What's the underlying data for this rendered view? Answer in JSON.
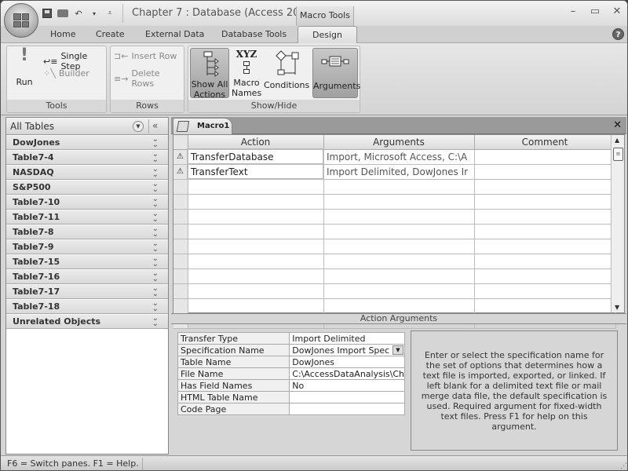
{
  "window": {
    "title": "Chapter 7 : Database (Access 20...",
    "context_tab_group": "Macro Tools",
    "controls": {
      "minimize": "–",
      "maximize": "▭",
      "close": "✕"
    }
  },
  "quick_access": [
    "save-icon",
    "print-icon",
    "undo-icon",
    "undo-dropdown-icon",
    "customize-icon"
  ],
  "tabs": [
    {
      "label": "Home",
      "active": false
    },
    {
      "label": "Create",
      "active": false
    },
    {
      "label": "External Data",
      "active": false
    },
    {
      "label": "Database Tools",
      "active": false
    },
    {
      "label": "Design",
      "active": true
    }
  ],
  "help_label": "?",
  "ribbon": {
    "groups": [
      {
        "label": "Tools",
        "run": "Run",
        "single_step": "Single Step",
        "builder": "Builder"
      },
      {
        "label": "Rows",
        "insert_row": "Insert Row",
        "delete_rows": "Delete Rows"
      },
      {
        "label": "Show/Hide",
        "show_all_actions": [
          "Show All",
          "Actions"
        ],
        "macro_names": [
          "Macro",
          "Names"
        ],
        "conditions": "Conditions",
        "arguments": "Arguments",
        "xyz": "XYZ"
      }
    ]
  },
  "nav_pane": {
    "title": "All Tables",
    "items": [
      "DowJones",
      "Table7-4",
      "NASDAQ",
      "S&P500",
      "Table7-10",
      "Table7-11",
      "Table7-8",
      "Table7-9",
      "Table7-15",
      "Table7-16",
      "Table7-17",
      "Table7-18",
      "Unrelated Objects"
    ]
  },
  "document": {
    "tab_label": "Macro1",
    "close": "✕",
    "columns": [
      "Action",
      "Arguments",
      "Comment"
    ],
    "rows": [
      {
        "warn": "⚠",
        "action": "TransferDatabase",
        "arguments": "Import, Microsoft Access, C:\\A",
        "comment": ""
      },
      {
        "warn": "⚠",
        "action": "TransferText",
        "arguments": "Import Delimited, DowJones Ir",
        "comment": ""
      }
    ],
    "empty_rows": 10
  },
  "action_arguments": {
    "header": "Action Arguments",
    "fields": [
      {
        "name": "Transfer Type",
        "value": "Import Delimited"
      },
      {
        "name": "Specification Name",
        "value": "DowJones Import Spec",
        "dropdown": true
      },
      {
        "name": "Table Name",
        "value": "DowJones"
      },
      {
        "name": "File Name",
        "value": "C:\\AccessDataAnalysis\\Ch"
      },
      {
        "name": "Has Field Names",
        "value": "No"
      },
      {
        "name": "HTML Table Name",
        "value": ""
      },
      {
        "name": "Code Page",
        "value": ""
      }
    ],
    "help_text": "Enter or select the specification name for the set of options that determines how a text file is imported, exported, or linked. If left blank for a delimited text file or mail merge data file, the default specification is used. Required argument for fixed-width text files. Press F1 for help on this argument."
  },
  "status_bar": {
    "text": "F6 = Switch panes.  F1 = Help."
  }
}
